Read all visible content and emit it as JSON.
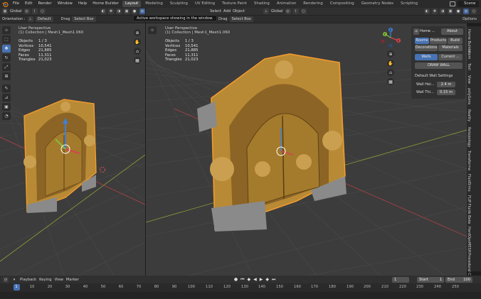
{
  "menubar": {
    "items": [
      "File",
      "Edit",
      "Render",
      "Window",
      "Help",
      "Home Builder"
    ],
    "workspaces": [
      "Layout",
      "Modeling",
      "Sculpting",
      "UV Editing",
      "Texture Paint",
      "Shading",
      "Animation",
      "Rendering",
      "Compositing",
      "Geometry Nodes",
      "Scripting"
    ],
    "active_workspace": "Layout",
    "scene": "Scene"
  },
  "left_header": {
    "mode_row": {
      "orientation_global": "Global",
      "snapping": "Global"
    },
    "tool_row": {
      "orientation_label": "Orientation :",
      "orientation_value": "Default",
      "drag_label": "Drag",
      "drag_value": "Select Box",
      "options": "Op"
    }
  },
  "right_header": {
    "menus": [
      "Select",
      "Add",
      "Object"
    ],
    "transform": "Global",
    "drag_label": "Drag",
    "drag_value": "Select Box",
    "options": "Options"
  },
  "tooltip": "Active workspace showing in the window.",
  "viewport_left": {
    "title": "User Perspective",
    "collection": "(1) Collection | Mesh1_Mesh1.060",
    "stats": [
      {
        "k": "Objects",
        "v": "1 / 3"
      },
      {
        "k": "Vertices",
        "v": "10,541"
      },
      {
        "k": "Edges",
        "v": "21,885"
      },
      {
        "k": "Faces",
        "v": "11,311"
      },
      {
        "k": "Triangles",
        "v": "21,023"
      }
    ]
  },
  "viewport_right": {
    "title": "User Perspective",
    "collection": "(1) Collection | Mesh1_Mesh1.060",
    "stats": [
      {
        "k": "Objects",
        "v": "1 / 3"
      },
      {
        "k": "Vertices",
        "v": "10,541"
      },
      {
        "k": "Edges",
        "v": "21,885"
      },
      {
        "k": "Faces",
        "v": "11,311"
      },
      {
        "k": "Triangles",
        "v": "21,023"
      }
    ]
  },
  "npanel": {
    "home": "Home ...",
    "about": "About",
    "tabs_row1": [
      "Rooms",
      "Products",
      "Build"
    ],
    "tabs_row2": [
      "Decorations",
      "Materials"
    ],
    "walls": "Walls",
    "current": "Current ...",
    "draw_wall": "DRAW WALL",
    "settings_title": "Default Wall Settings",
    "wall_height_label": "Wall Hei...",
    "wall_height_value": "2.4 m",
    "wall_thickness_label": "Wall Thi...",
    "wall_thickness_value": "0.15 m"
  },
  "side_tabs": [
    "Home Builder",
    "Item",
    "Tool",
    "View",
    "polyGons",
    "Reality",
    "Retopology",
    "Transforma",
    "FluidSimu",
    "FLIP Fluids",
    "Bake",
    "HardOps",
    "MESH",
    "Procedural Cri"
  ],
  "timeline": {
    "menus": [
      "Playback",
      "Keying",
      "View",
      "Marker"
    ],
    "current_frame": "1",
    "start_label": "Start",
    "start": "1",
    "end_label": "End",
    "end": "100",
    "ruler": [
      "1",
      "10",
      "20",
      "30",
      "40",
      "50",
      "60",
      "70",
      "80",
      "90",
      "100",
      "110",
      "120",
      "130",
      "140",
      "150",
      "160",
      "170",
      "180",
      "190",
      "200",
      "210",
      "220",
      "230",
      "240",
      "250"
    ]
  },
  "gizmo_labels": {
    "x": "X",
    "y": "Y",
    "z": "Z"
  },
  "colors": {
    "accent": "#4772b3",
    "selection": "#e8892a",
    "x_axis": "#d2464e",
    "y_axis": "#7fbf3a",
    "z_axis": "#3e7fd8"
  }
}
